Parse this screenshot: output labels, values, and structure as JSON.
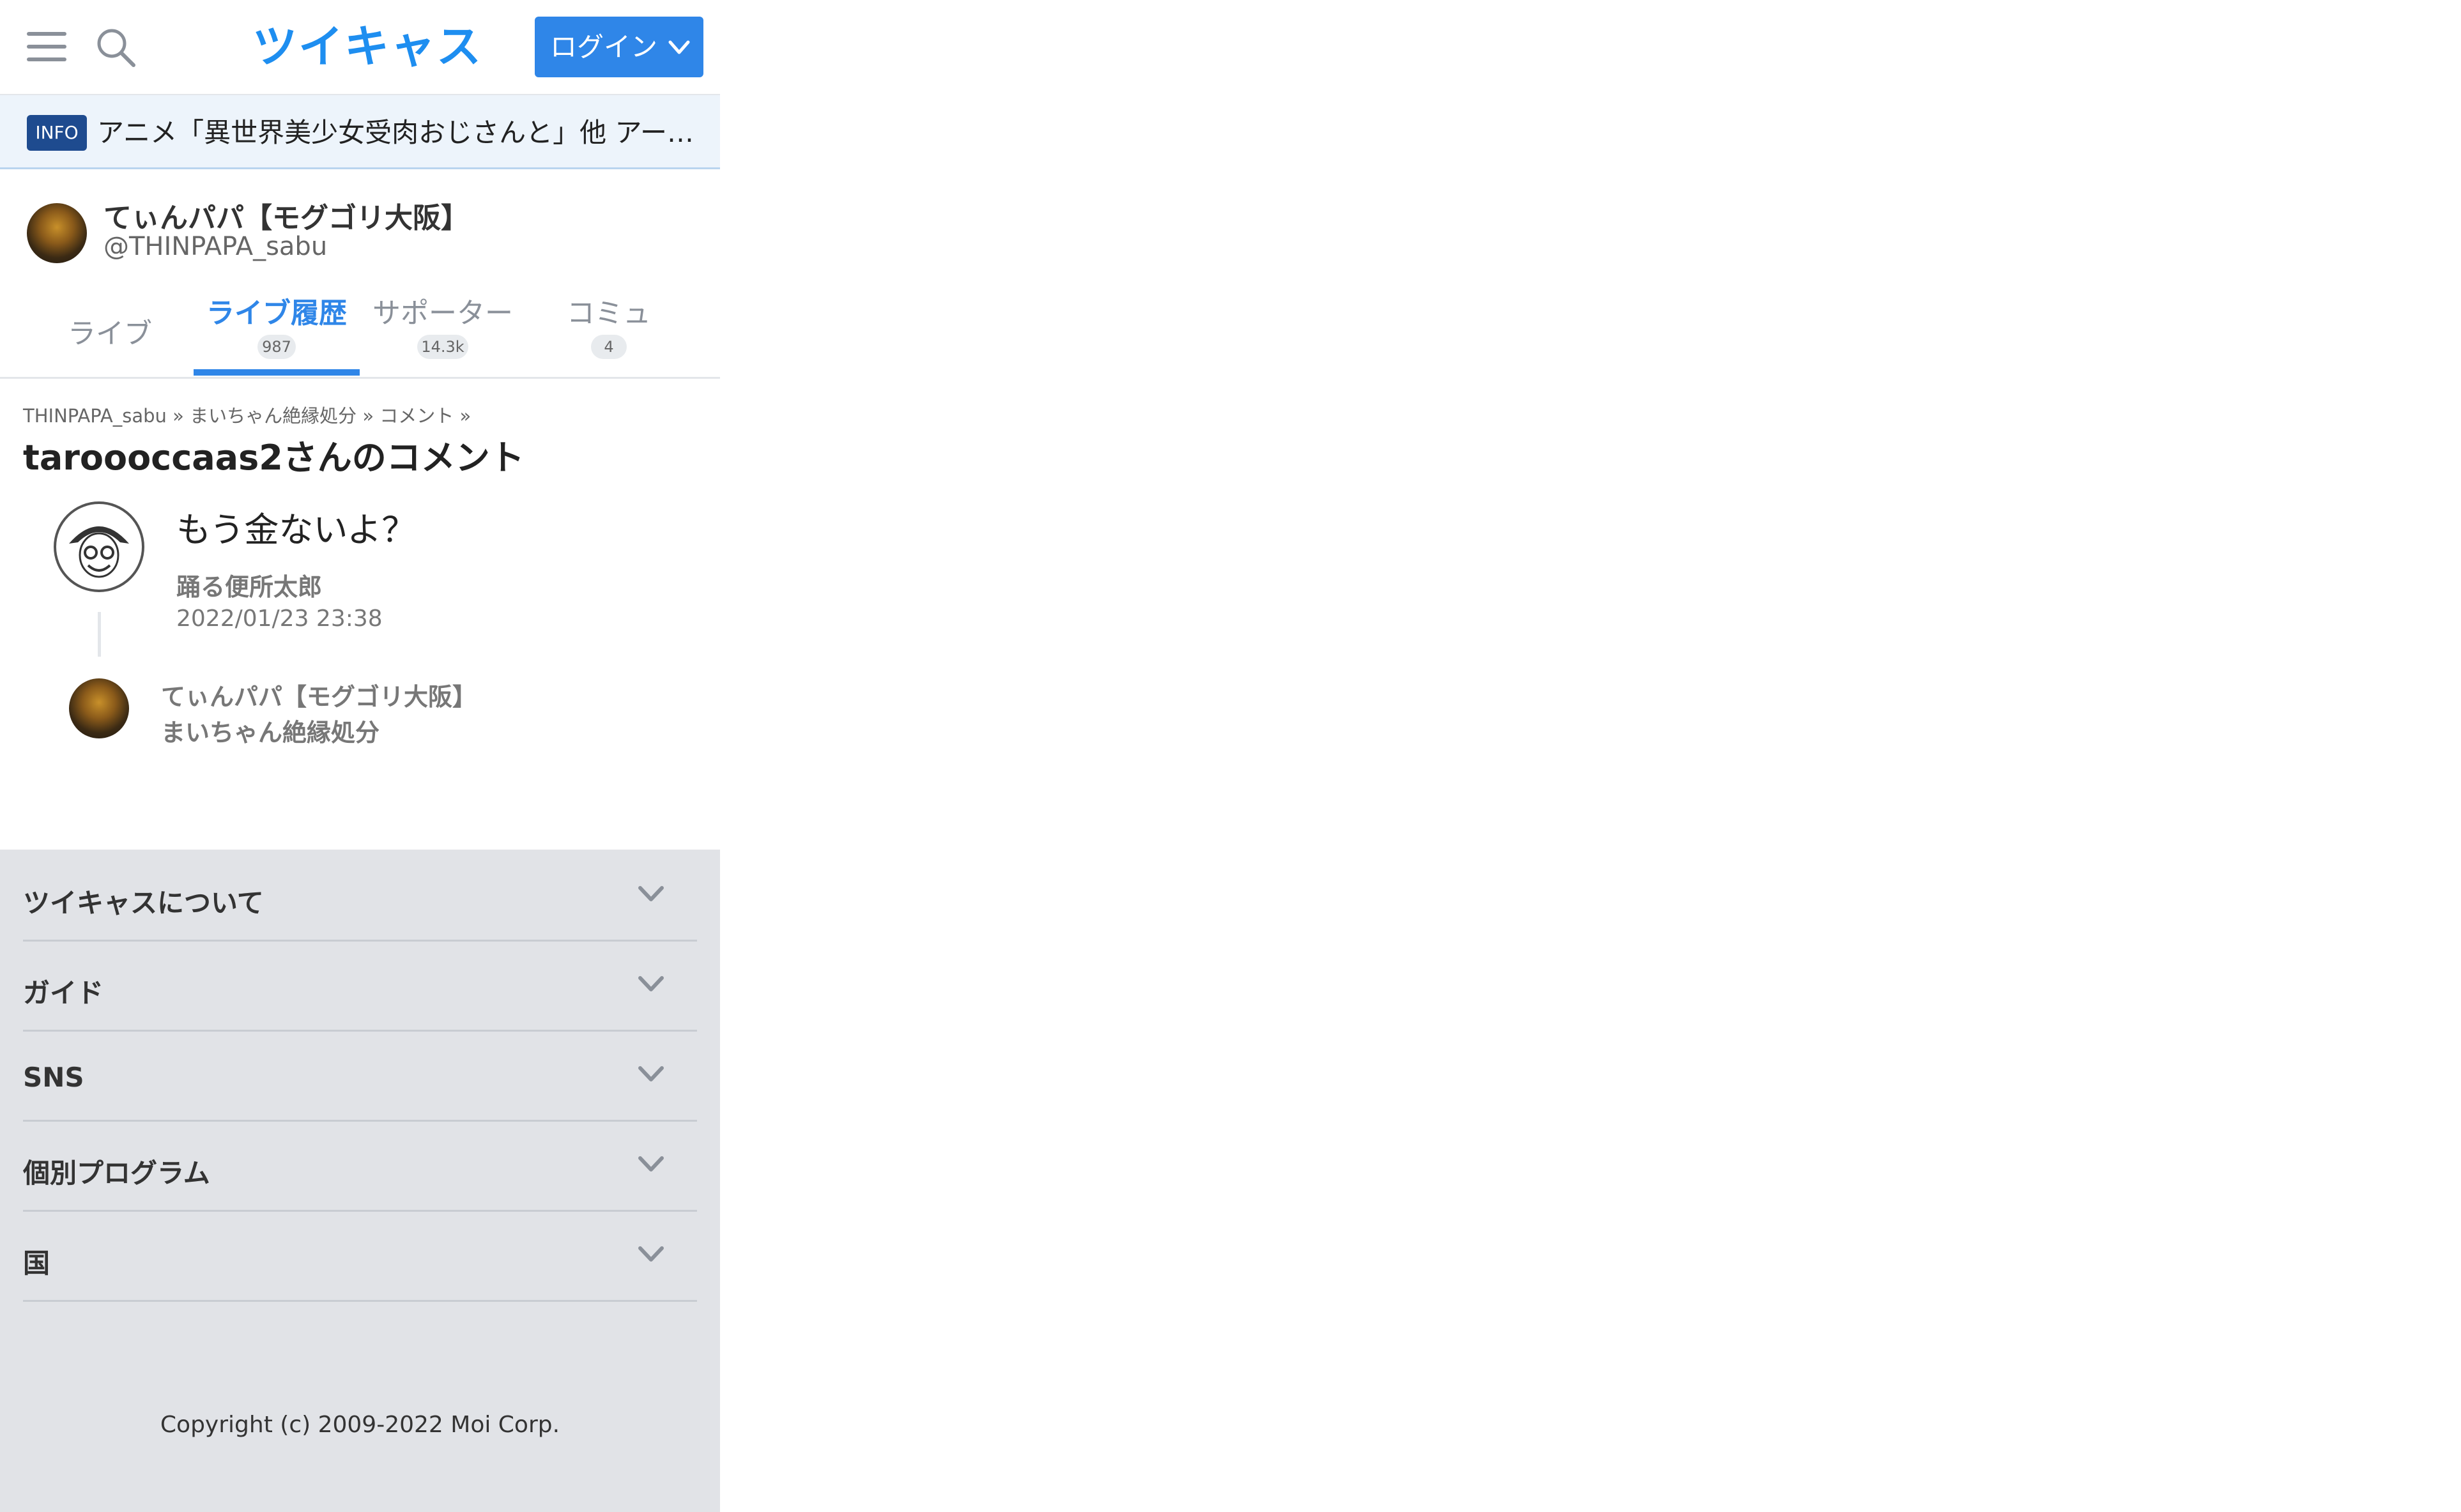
{
  "header": {
    "logo_text": "ツイキャス",
    "login_label": "ログイン",
    "icons": [
      "menu-icon",
      "search-icon",
      "chevron-down-icon"
    ]
  },
  "info": {
    "badge": "INFO",
    "text": "アニメ「異世界美少女受肉おじさんと」他 アーティストによる配信"
  },
  "user": {
    "name": "てぃんパパ【モグゴリ大阪】",
    "handle": "@THINPAPA_sabu"
  },
  "tabs": [
    {
      "label": "ライブ",
      "count": ""
    },
    {
      "label": "ライブ履歴",
      "count": "987"
    },
    {
      "label": "サポーター",
      "count": "14.3k"
    },
    {
      "label": "コミュ",
      "count": "4"
    }
  ],
  "breadcrumb": {
    "items": [
      "THINPAPA_sabu",
      "まいちゃん絶縁処分",
      "コメント"
    ],
    "separator": "»"
  },
  "page_title": "taroooccaas2さんのコメント",
  "comment": {
    "text": "もう金ないよ？",
    "author": "踊る便所太郎",
    "time": "2022/01/23 23:38"
  },
  "movie": {
    "user": "てぃんパパ【モグゴリ大阪】",
    "title": "まいちゃん絶縁処分"
  },
  "footer": {
    "sections": [
      "ツイキャスについて",
      "ガイド",
      "SNS",
      "個別プログラム",
      "国"
    ],
    "copyright": "Copyright (c) 2009-2022 Moi Corp."
  },
  "colors": {
    "brand": "#1e8ef0",
    "login_bg": "#2f86e8",
    "active_tab": "#2f86e8",
    "info_badge": "#1e4b8f",
    "footer_bg": "#e1e3e7"
  }
}
